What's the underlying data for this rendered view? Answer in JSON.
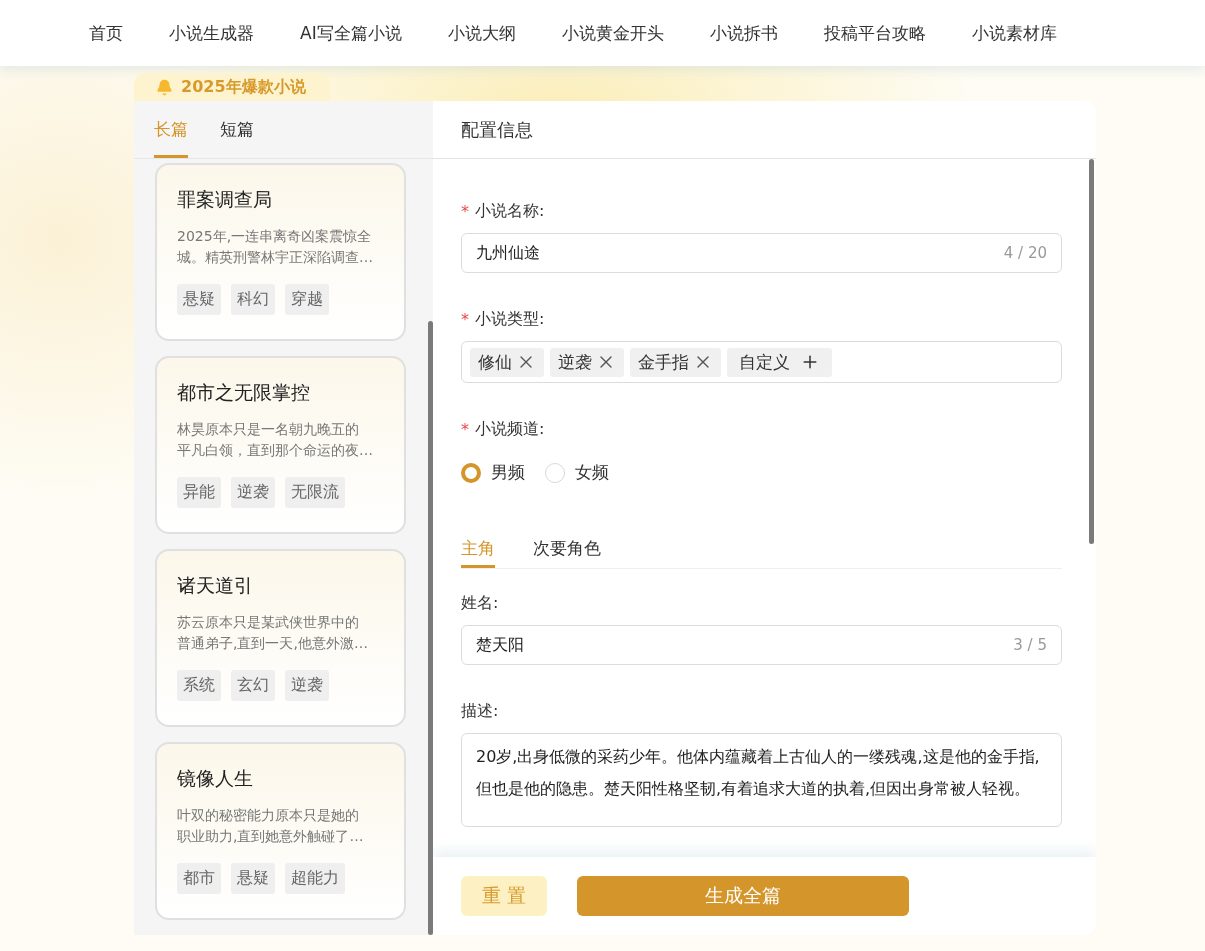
{
  "nav": {
    "items": [
      {
        "label": "首页"
      },
      {
        "label": "小说生成器"
      },
      {
        "label": "AI写全篇小说"
      },
      {
        "label": "小说大纲"
      },
      {
        "label": "小说黄金开头"
      },
      {
        "label": "小说拆书"
      },
      {
        "label": "投稿平台攻略"
      },
      {
        "label": "小说素材库"
      }
    ]
  },
  "badge": {
    "label": "2025年爆款小说"
  },
  "sidebar": {
    "tabs": [
      {
        "label": "长篇",
        "selected": true
      },
      {
        "label": "短篇",
        "selected": false
      }
    ],
    "cards": [
      {
        "title": "罪案调查局",
        "lines": [
          "2025年,一连串离奇凶案震惊全",
          "城。精英刑警林宇正深陷调查…"
        ],
        "tags": [
          "悬疑",
          "科幻",
          "穿越"
        ]
      },
      {
        "title": "都市之无限掌控",
        "lines": [
          "林昊原本只是一名朝九晚五的",
          "平凡白领，直到那个命运的夜…"
        ],
        "tags": [
          "异能",
          "逆袭",
          "无限流"
        ]
      },
      {
        "title": "诸天道引",
        "lines": [
          "苏云原本只是某武侠世界中的",
          "普通弟子,直到一天,他意外激…"
        ],
        "tags": [
          "系统",
          "玄幻",
          "逆袭"
        ]
      },
      {
        "title": "镜像人生",
        "lines": [
          "叶双的秘密能力原本只是她的",
          "职业助力,直到她意外触碰了…"
        ],
        "tags": [
          "都市",
          "悬疑",
          "超能力"
        ]
      }
    ]
  },
  "form": {
    "title": "配置信息",
    "required_mark": "*",
    "name_field": {
      "label": "小说名称:",
      "required": true,
      "value": "九州仙途",
      "count": "4 / 20"
    },
    "genre_field": {
      "label": "小说类型:",
      "required": true,
      "tags": [
        {
          "label": "修仙"
        },
        {
          "label": "逆袭"
        },
        {
          "label": "金手指"
        }
      ],
      "add_label": "自定义"
    },
    "channel_field": {
      "label": "小说频道:",
      "required": true,
      "options": [
        {
          "label": "男频",
          "selected": true
        },
        {
          "label": "女频",
          "selected": false
        }
      ]
    },
    "role_tabs": [
      {
        "label": "主角",
        "selected": true
      },
      {
        "label": "次要角色",
        "selected": false
      }
    ],
    "role_name": {
      "label": "姓名:",
      "value": "楚天阳",
      "count": "3 / 5"
    },
    "role_desc": {
      "label": "描述:",
      "value": "20岁,出身低微的采药少年。他体内蕴藏着上古仙人的一缕残魂,这是他的金手指,但也是他的隐患。楚天阳性格坚韧,有着追求大道的执着,但因出身常被人轻视。"
    }
  },
  "footer": {
    "buttons": [
      {
        "label": "重 置",
        "kind": "secondary"
      },
      {
        "label": "生成全篇",
        "kind": "primary"
      }
    ]
  }
}
